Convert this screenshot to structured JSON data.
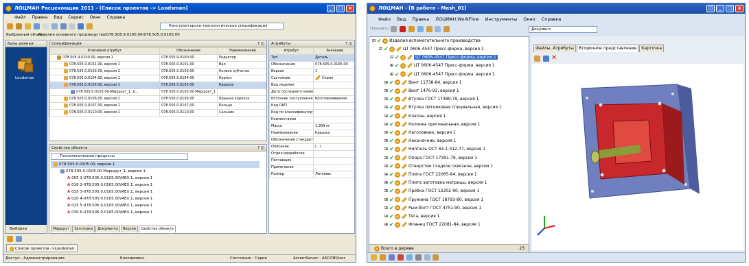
{
  "left": {
    "title": "ЛОЦМАН Расцеховщик 2011 - [Список проектов -> Loodsman]",
    "menu": [
      "Файл",
      "Правка",
      "Вид",
      "Сервис",
      "Окно",
      "Справка"
    ],
    "toolbar_combo": "Конструкторско-технологическая спецификация",
    "selected_label": "Выбранный объект",
    "selected_value": "Изделия основного производства\\078.505.9.0100.00\\078.505.0.0105.00",
    "nav_header": "Базы данных",
    "nav_db": "Loodsman",
    "nav_bottom": "Выборки",
    "spec_header": "Спецификация",
    "spec_cols": [
      "Ключевой атрибут",
      "Обозначение",
      "Наименование"
    ],
    "spec_rows": [
      {
        "key": "078.505.9.0100.00, версия 1",
        "code": "078.505.9.0100.00",
        "name": "Редуктор"
      },
      {
        "key": "078.505.0.0101.00, версия 1",
        "code": "078.505.0.0101.00",
        "name": "Вал"
      },
      {
        "key": "078.505.0.0103.00, версия 2",
        "code": "078.505.0.0103.00",
        "name": "Колесо зубчатое"
      },
      {
        "key": "078.505.0.0104.00, версия 1",
        "code": "078.505.0.0104.00",
        "name": "Корпус"
      },
      {
        "key": "078.505.0.0105.00, версия 1",
        "code": "078.505.0.0105.00",
        "name": "Крышка"
      },
      {
        "key": "078.505.0.0105.00 Маршрут_1, в...",
        "code": "078.505.0.0105.00 Маршрут_1",
        "name": ""
      },
      {
        "key": "078.505.0.0106.00, версия 1",
        "code": "078.505.0.0106.00",
        "name": "Крышка корпуса"
      },
      {
        "key": "078.505.0.0107.00, версия 1",
        "code": "078.505.0.0107.00",
        "name": "Кольцо"
      },
      {
        "key": "078.505.0.0110.00, версия 1",
        "code": "078.505.0.0110.00",
        "name": "Сальник"
      }
    ],
    "props_header": "Свойства объекта",
    "props_combo": "Технологические процессы",
    "props_rows": [
      "078.505.0.0105.00, версия 1",
      "078.505.0.0105.00 Маршрут_1, версия 1",
      "005 1-078.505.0.0105.00\\МЕХ.1, версия 1",
      "010 2-078.505.0.0105.00\\МЕХ.1, версия 1",
      "015 3-078.505.0.0105.00\\МЕХ.1, версия 1",
      "020 4-078.505.0.0105.00\\МЕХ.1, версия 1",
      "025 5-078.505.0.0105.00\\МЕХ.1, версия 1",
      "030 6-078.505.0.0105.00\\МЕХ.1, версия 1"
    ],
    "props_tabs": [
      "Маршрут",
      "Заготовка",
      "Документы",
      "Версии",
      "Свойства объекта"
    ],
    "attrs_header": "Атрибуты",
    "attrs_cols": [
      "Атрибут",
      "Значение"
    ],
    "attrs_rows": [
      {
        "a": "Тип",
        "v": "Деталь"
      },
      {
        "a": "Обозначение",
        "v": "078.505.0.0105.00"
      },
      {
        "a": "Версия",
        "v": "1"
      },
      {
        "a": "Состояние",
        "v": "Серия"
      },
      {
        "a": "Вид изделия",
        "v": ""
      },
      {
        "a": "Дата последнего изменения",
        "v": ""
      },
      {
        "a": "Источник поступления",
        "v": "Изготавливаемое"
      },
      {
        "a": "Код ОКП",
        "v": ""
      },
      {
        "a": "Код по классификатору",
        "v": ""
      },
      {
        "a": "Комментарии",
        "v": ""
      },
      {
        "a": "Масса",
        "v": "1.909 кг"
      },
      {
        "a": "Наименование",
        "v": "Крышка"
      },
      {
        "a": "Обозначение стандарта",
        "v": ""
      },
      {
        "a": "Описание",
        "v": "(...)"
      },
      {
        "a": "Отдел разработки",
        "v": ""
      },
      {
        "a": "Поставщик",
        "v": ""
      },
      {
        "a": "Примечание",
        "v": ""
      },
      {
        "a": "Размер",
        "v": "Литьевы"
      }
    ],
    "task_item": "Список проектов ->Loodsman",
    "status_user": "Доступ - Администрирование",
    "status_mid": "Блокировка -",
    "status_state": "Состояние - Серия",
    "status_right": "AscomServer - ASCON\\User"
  },
  "right": {
    "title": "ЛОЦМАН - [В работе - Mash_01]",
    "menu": [
      "Файл",
      "Вид",
      "Правка",
      "ЛОЦМАН:WorkFlow",
      "Инструменты",
      "Окно",
      "Справка"
    ],
    "show_btn": "Показать",
    "doc_combo": "Документ",
    "tree_root": "Изделия вспомогательного производства",
    "tree_rows": [
      "ЦТ 0606-4547 Пресс-форма, версия 1",
      "ЦТ 0606-4547 Пресс-форма, версия 1",
      "ЦТ 0606-4547 Пресс-форма, версия 1",
      "ЦТ 0606-4547 Пресс-форма, версия 1",
      "Винт 11738-84, версия 1",
      "Винт 1476-93, версия 1",
      "Втулка ГОСТ 17389-79, версия 1",
      "Втулка литниковая специальная, версия 1",
      "Клапан, версия 1",
      "Колонка оригинальная, версия 1",
      "Наголовник, версия 1",
      "Наконечник, версия 1",
      "Ниппель ОСТ 64-1-312-77, версия 1",
      "Опора ГОСТ 17391-79, версия 1",
      "Отверстие гладкое сквозное, версия 1",
      "Плита ГОСТ 22065-84, версия 1",
      "Плита заготовка матрицы, версия 1",
      "Пробка ГОСТ 12202-90, версия 1",
      "Пружина ГОСТ 18793-80, версия 1",
      "Рым-болт ГОСТ 4751-90, версия 1",
      "Тяга, версия 1",
      "Фланец ГОСТ 22081-84, версия 1"
    ],
    "total_label": "Всего в дереве",
    "total_count": "23",
    "tabs": [
      "Файлы, Атрибуты",
      "Вторичное представление",
      "Карточка"
    ]
  },
  "colors": {
    "accent": "#0a5fd8",
    "selection": "#316ac5",
    "model_red": "#c8282c",
    "model_plate": "#6f7fc0"
  }
}
